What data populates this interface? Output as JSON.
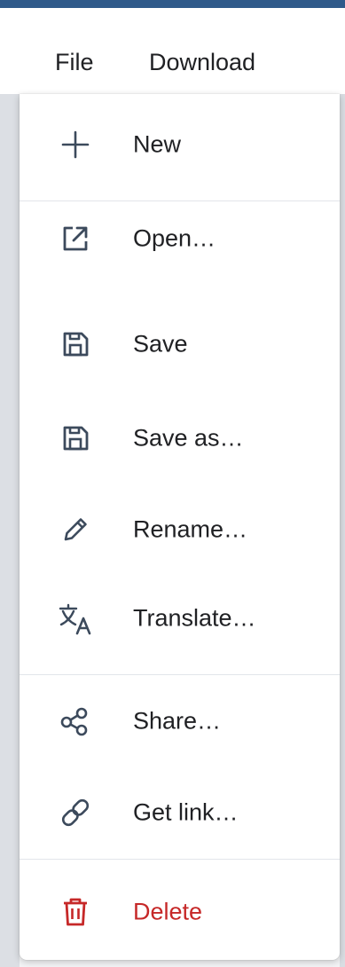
{
  "menubar": {
    "file_label": "File",
    "download_label": "Download"
  },
  "menu": {
    "new_label": "New",
    "open_label": "Open…",
    "save_label": "Save",
    "save_as_label": "Save as…",
    "rename_label": "Rename…",
    "translate_label": "Translate…",
    "share_label": "Share…",
    "get_link_label": "Get link…",
    "delete_label": "Delete"
  },
  "icons": {
    "new": "plus-icon",
    "open": "open-external-icon",
    "save": "floppy-disk-icon",
    "save_as": "floppy-disk-icon",
    "rename": "pencil-icon",
    "translate": "translate-icon",
    "share": "share-icon",
    "get_link": "link-icon",
    "delete": "trash-icon"
  },
  "colors": {
    "header_stripe": "#2f5a8a",
    "text": "#202124",
    "icon": "#3c4a5c",
    "danger": "#c62828"
  }
}
